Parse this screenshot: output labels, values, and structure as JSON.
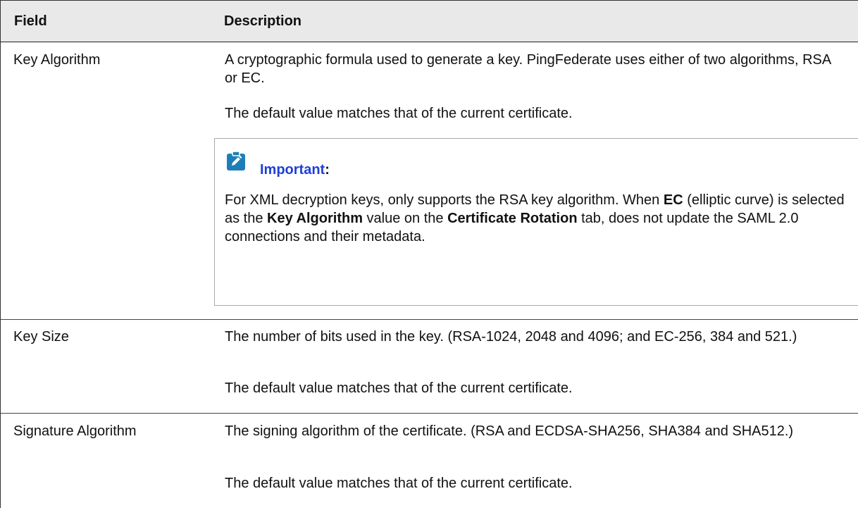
{
  "header": {
    "field": "Field",
    "description": "Description"
  },
  "rows": [
    {
      "field": "Key Algorithm",
      "p1": "A cryptographic formula used to generate a key. PingFederate uses either of two algorithms, RSA or EC.",
      "p2": "The default value matches that of the current certificate.",
      "note": {
        "title": "Important",
        "colon": ":",
        "body_parts": [
          "For XML decryption keys,  only supports the RSA key algorithm. When ",
          "EC",
          " (elliptic curve) is selected as the ",
          "Key Algorithm",
          " value on the ",
          "Certificate Rotation",
          " tab,  does not update the SAML 2.0 connections and their metadata."
        ]
      }
    },
    {
      "field": "Key Size",
      "p1": "The number of bits used in the key. (RSA-1024, 2048 and 4096; and EC-256, 384 and 521.)",
      "p2": "The default value matches that of the current certificate."
    },
    {
      "field": "Signature Algorithm",
      "p1": "The signing algorithm of the certificate. (RSA and ECDSA-SHA256, SHA384 and SHA512.)",
      "p2": "The default value matches that of the current certificate."
    }
  ],
  "colors": {
    "note_title": "#1e3fd8",
    "note_icon": "#1e7fb8",
    "header_bg": "#e9e9e9"
  },
  "icons": {
    "note": "pencil-clipboard-icon"
  }
}
